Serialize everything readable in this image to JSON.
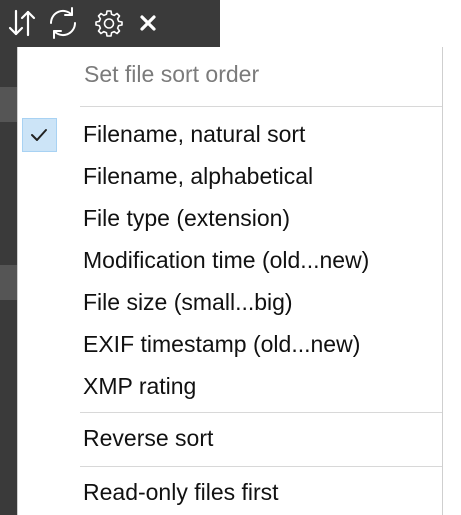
{
  "toolbar": {
    "buttons": [
      {
        "icon": "sort-arrows-icon"
      },
      {
        "icon": "refresh-icon"
      },
      {
        "icon": "gear-icon"
      },
      {
        "icon": "close-icon"
      }
    ]
  },
  "menu": {
    "header": "Set file sort order",
    "items": [
      {
        "label": "Filename, natural sort",
        "checked": true
      },
      {
        "label": "Filename, alphabetical",
        "checked": false
      },
      {
        "label": "File type (extension)",
        "checked": false
      },
      {
        "label": "Modification time (old...new)",
        "checked": false
      },
      {
        "label": "File size (small...big)",
        "checked": false
      },
      {
        "label": "EXIF timestamp (old...new)",
        "checked": false
      },
      {
        "label": "XMP rating",
        "checked": false
      }
    ],
    "reverse_label": "Reverse sort",
    "readonly_label": "Read-only files first"
  },
  "colors": {
    "toolbar_bg": "#3a3a3a",
    "check_highlight": "#cce4f7",
    "header_text": "#7b7b7b"
  }
}
